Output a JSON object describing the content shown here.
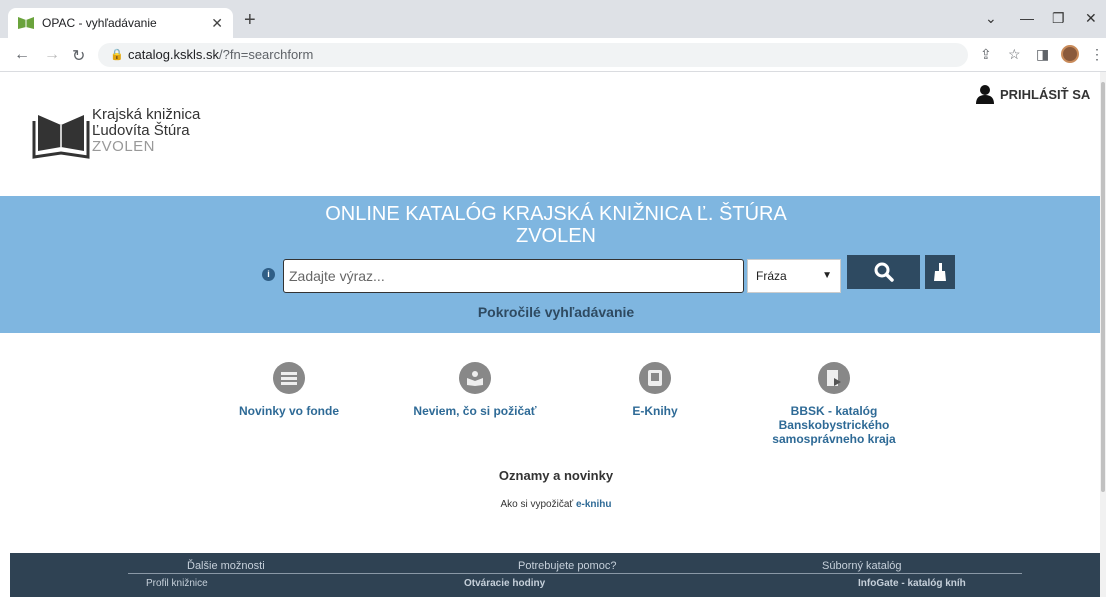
{
  "browser": {
    "tab_title": "OPAC - vyhľadávanie",
    "url_host": "catalog.kskls.sk",
    "url_path": "/?fn=searchform"
  },
  "header": {
    "logo_line1": "Krajská knižnica",
    "logo_line2": "Ľudovíta Štúra",
    "logo_line3": "ZVOLEN",
    "login_label": "PRIHLÁSIŤ SA"
  },
  "search": {
    "title_line1": "ONLINE KATALÓG KRAJSKÁ KNIŽNICA Ľ. ŠTÚRA",
    "title_line2": "ZVOLEN",
    "placeholder": "Zadajte výraz...",
    "mode_selected": "Fráza",
    "advanced_label": "Pokročilé vyhľadávanie",
    "info_glyph": "i"
  },
  "quick_links": [
    {
      "label": "Novinky vo fonde",
      "icon": "books-icon"
    },
    {
      "label": "Neviem, čo si požičať",
      "icon": "reader-icon"
    },
    {
      "label": "E-Knihy",
      "icon": "ebook-icon"
    },
    {
      "label": "BBSK - katalóg Banskobystrického samosprávneho kraja",
      "icon": "catalog-icon"
    }
  ],
  "news": {
    "title": "Oznamy a novinky",
    "text_prefix": "Ako si vypožičať",
    "link_label": "e-knihu"
  },
  "footer": {
    "col1": "Ďalšie možnosti",
    "col2": "Potrebujete pomoc?",
    "col3": "Súborný katalóg",
    "sub1": "Profil knižnice",
    "sub2": "Otváracie hodiny",
    "sub3": "InfoGate - katalóg kníh"
  },
  "colors": {
    "banner": "#7fb6e0",
    "button": "#2e4a61",
    "link": "#2e6a96",
    "footer": "#2f4253"
  }
}
